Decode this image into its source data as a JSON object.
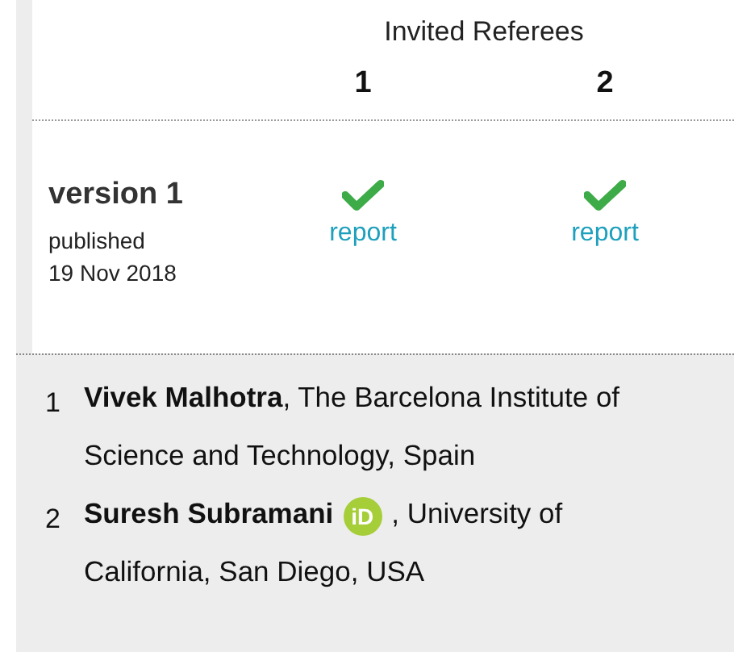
{
  "header": {
    "title": "Invited Referees",
    "referees": [
      "1",
      "2"
    ]
  },
  "versions": [
    {
      "label": "version 1",
      "published": "published",
      "date": "19 Nov 2018",
      "reports": [
        {
          "approved": true,
          "link": "report"
        },
        {
          "approved": true,
          "link": "report"
        }
      ]
    }
  ],
  "referees": [
    {
      "number": "1",
      "name": "Vivek Malhotra",
      "affiliation": ", The Barcelona Institute of Science and Technology, Spain"
    },
    {
      "number": "2",
      "name": "Suresh Subramani",
      "orcid": "iD",
      "affiliation": ", University of California, San Diego, USA"
    }
  ]
}
